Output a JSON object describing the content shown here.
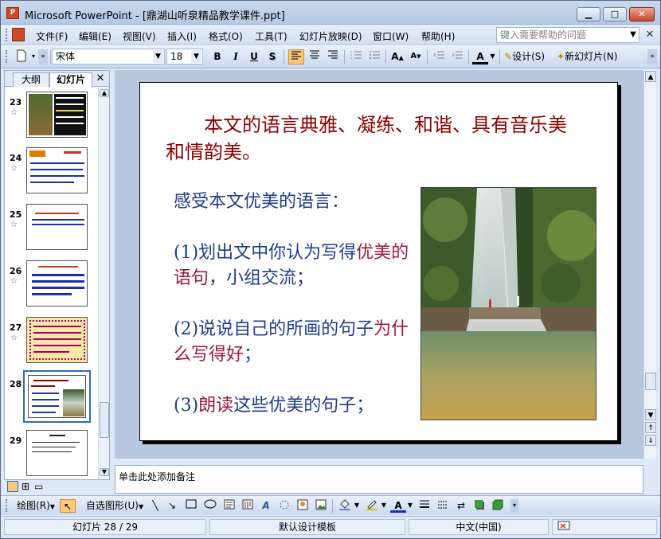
{
  "window": {
    "title": "Microsoft PowerPoint - [鼎湖山听泉精品教学课件.ppt]",
    "app_icon_text": "P",
    "minimize": "▁",
    "maximize": "□",
    "close": "✕"
  },
  "menubar": {
    "items": [
      "文件(F)",
      "编辑(E)",
      "视图(V)",
      "插入(I)",
      "格式(O)",
      "工具(T)",
      "幻灯片放映(D)",
      "窗口(W)",
      "帮助(H)"
    ],
    "help_placeholder": "键入需要帮助的问题"
  },
  "format_toolbar": {
    "font_name": "宋体",
    "font_size": "18",
    "bold": "B",
    "italic": "I",
    "underline": "U",
    "shadow": "S",
    "design_label": "设计(S)",
    "new_slide_label": "新幻灯片(N)"
  },
  "left_pane": {
    "tab_outline": "大纲",
    "tab_slides": "幻灯片",
    "close": "✕",
    "slide_numbers": [
      "23",
      "24",
      "25",
      "26",
      "27",
      "28",
      "29"
    ],
    "selected_slide": "28"
  },
  "slide": {
    "title": "　　本文的语言典雅、凝练、和谐、具有音乐美和情韵美。",
    "line1": "感受本文优美的语言：",
    "item1_a": "(1)划出文中你认为写得",
    "item1_b": "优美的语句",
    "item1_c": "，小组交流；",
    "item2_a": "(2)说说自己的所画的句子",
    "item2_b": "为什么写得好",
    "item2_c": "；",
    "item3_a": "(3)",
    "item3_b": "朗读",
    "item3_c": "这些优美的句子；"
  },
  "notes": {
    "placeholder": "单击此处添加备注"
  },
  "drawing_toolbar": {
    "draw_label": "绘图(R)",
    "autoshapes_label": "自选图形(U)"
  },
  "statusbar": {
    "slide_counter": "幻灯片 28 / 29",
    "template": "默认设计模板",
    "language": "中文(中国)"
  },
  "colors": {
    "title_red": "#8b0000",
    "body_blue": "#1f3c88",
    "accent_red": "#9c1a3a",
    "selection": "#316ac5"
  }
}
